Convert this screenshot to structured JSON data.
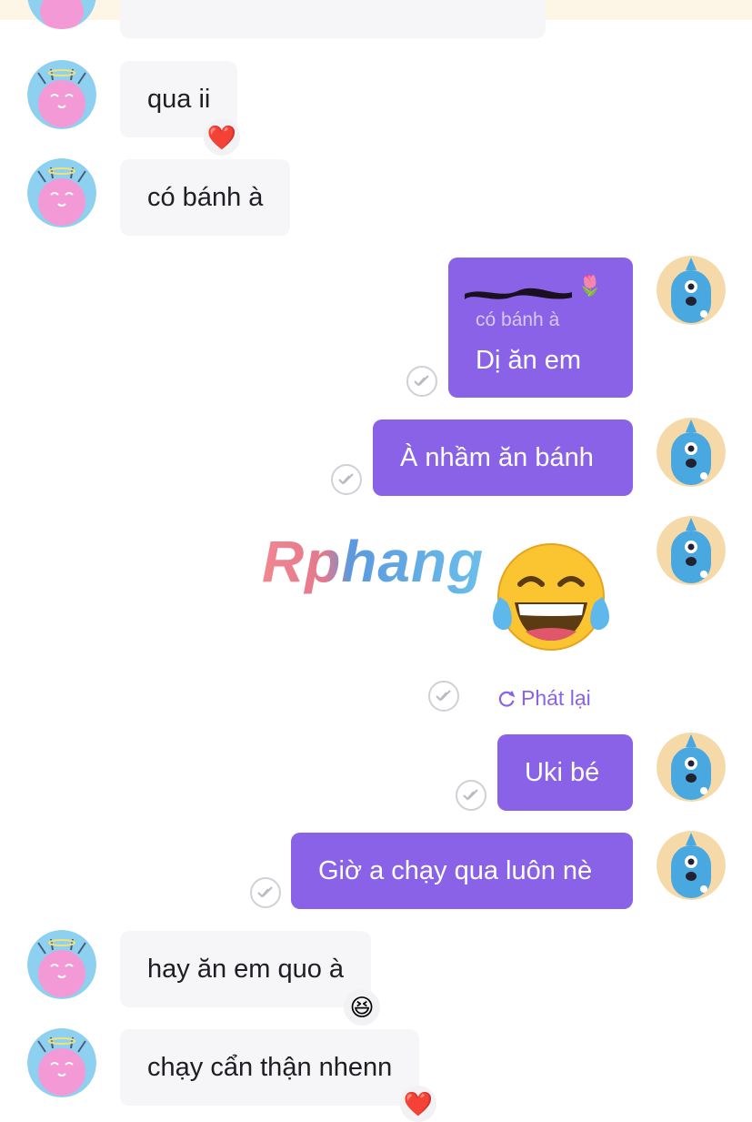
{
  "messages": [
    {
      "id": "m1",
      "text": "qua ii",
      "reaction": "❤️"
    },
    {
      "id": "m2",
      "text": "có bánh à"
    },
    {
      "id": "m3",
      "quote": "có bánh à",
      "text": "Dị ăn em",
      "quote_emoji": "🌷"
    },
    {
      "id": "m4",
      "text": "À nhầm ăn bánh"
    },
    {
      "id": "m5",
      "sticker": "tears-of-joy-emoji",
      "status": "Phát lại"
    },
    {
      "id": "m6",
      "text": "Uki bé"
    },
    {
      "id": "m7",
      "text": "Giờ a chạy qua luôn nè"
    },
    {
      "id": "m8",
      "text": "hay ăn em quo à",
      "reaction": "😆"
    },
    {
      "id": "m9",
      "text": "chạy cẩn thận nhenn",
      "reaction": "❤️"
    }
  ],
  "watermark": "Rphang",
  "colors": {
    "outgoing": "#8a62e8",
    "incoming": "#f6f6f8",
    "accent": "#8a62e8"
  }
}
